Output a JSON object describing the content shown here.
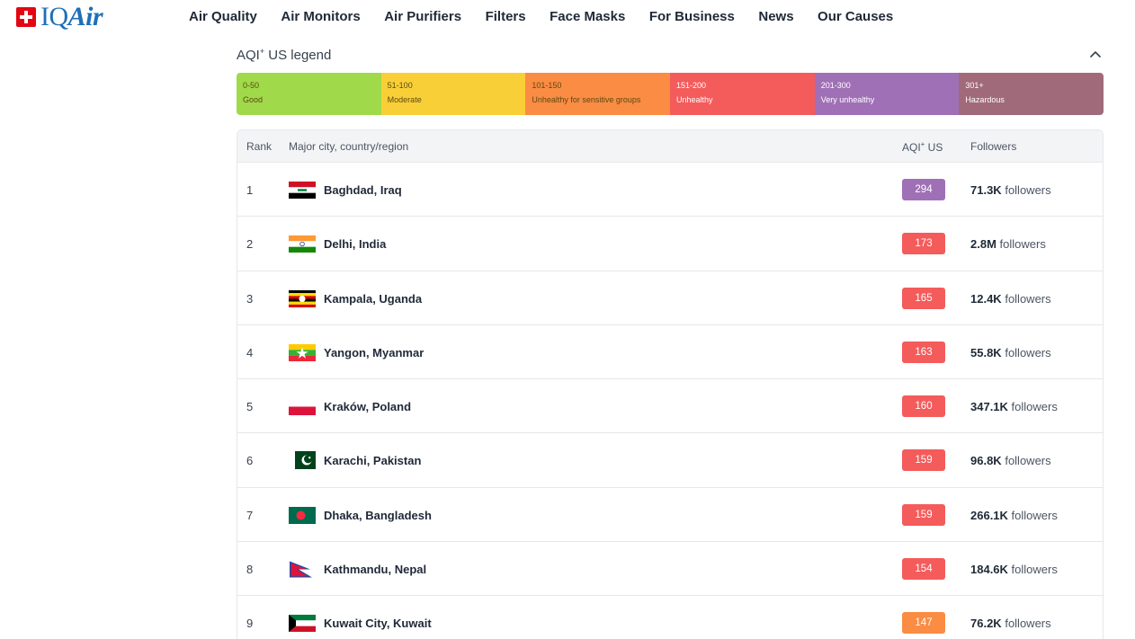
{
  "header": {
    "logo": {
      "iq": "IQ",
      "air": "Air"
    },
    "nav": [
      "Air Quality",
      "Air Monitors",
      "Air Purifiers",
      "Filters",
      "Face Masks",
      "For Business",
      "News",
      "Our Causes"
    ]
  },
  "legend": {
    "title": "AQI",
    "title_sup": "+",
    "title_suffix": " US legend",
    "segments": [
      {
        "range": "0-50",
        "label": "Good",
        "color": "#a0d94a"
      },
      {
        "range": "51-100",
        "label": "Moderate",
        "color": "#f9cf37"
      },
      {
        "range": "101-150",
        "label": "Unhealthy for sensitive groups",
        "color": "#fa8c43"
      },
      {
        "range": "151-200",
        "label": "Unhealthy",
        "color": "#f45b5b"
      },
      {
        "range": "201-300",
        "label": "Very unhealthy",
        "color": "#a070b6"
      },
      {
        "range": "301+",
        "label": "Hazardous",
        "color": "#a06a7b"
      }
    ]
  },
  "table": {
    "headers": {
      "rank": "Rank",
      "city": "Major city, country/region",
      "aqi": "AQI",
      "aqi_sup": "+",
      "aqi_suffix": " US",
      "followers": "Followers"
    },
    "followers_word": "followers",
    "rows": [
      {
        "rank": "1",
        "city": "Baghdad, Iraq",
        "flag": "iq",
        "aqi": "294",
        "aqi_color": "#a070b6",
        "followers": "71.3K"
      },
      {
        "rank": "2",
        "city": "Delhi, India",
        "flag": "in",
        "aqi": "173",
        "aqi_color": "#f45b5b",
        "followers": "2.8M"
      },
      {
        "rank": "3",
        "city": "Kampala, Uganda",
        "flag": "ug",
        "aqi": "165",
        "aqi_color": "#f45b5b",
        "followers": "12.4K"
      },
      {
        "rank": "4",
        "city": "Yangon, Myanmar",
        "flag": "mm",
        "aqi": "163",
        "aqi_color": "#f45b5b",
        "followers": "55.8K"
      },
      {
        "rank": "5",
        "city": "Kraków, Poland",
        "flag": "pl",
        "aqi": "160",
        "aqi_color": "#f45b5b",
        "followers": "347.1K"
      },
      {
        "rank": "6",
        "city": "Karachi, Pakistan",
        "flag": "pk",
        "aqi": "159",
        "aqi_color": "#f45b5b",
        "followers": "96.8K"
      },
      {
        "rank": "7",
        "city": "Dhaka, Bangladesh",
        "flag": "bd",
        "aqi": "159",
        "aqi_color": "#f45b5b",
        "followers": "266.1K"
      },
      {
        "rank": "8",
        "city": "Kathmandu, Nepal",
        "flag": "np",
        "aqi": "154",
        "aqi_color": "#f45b5b",
        "followers": "184.6K"
      },
      {
        "rank": "9",
        "city": "Kuwait City, Kuwait",
        "flag": "kw",
        "aqi": "147",
        "aqi_color": "#fa8c43",
        "followers": "76.2K"
      }
    ]
  }
}
